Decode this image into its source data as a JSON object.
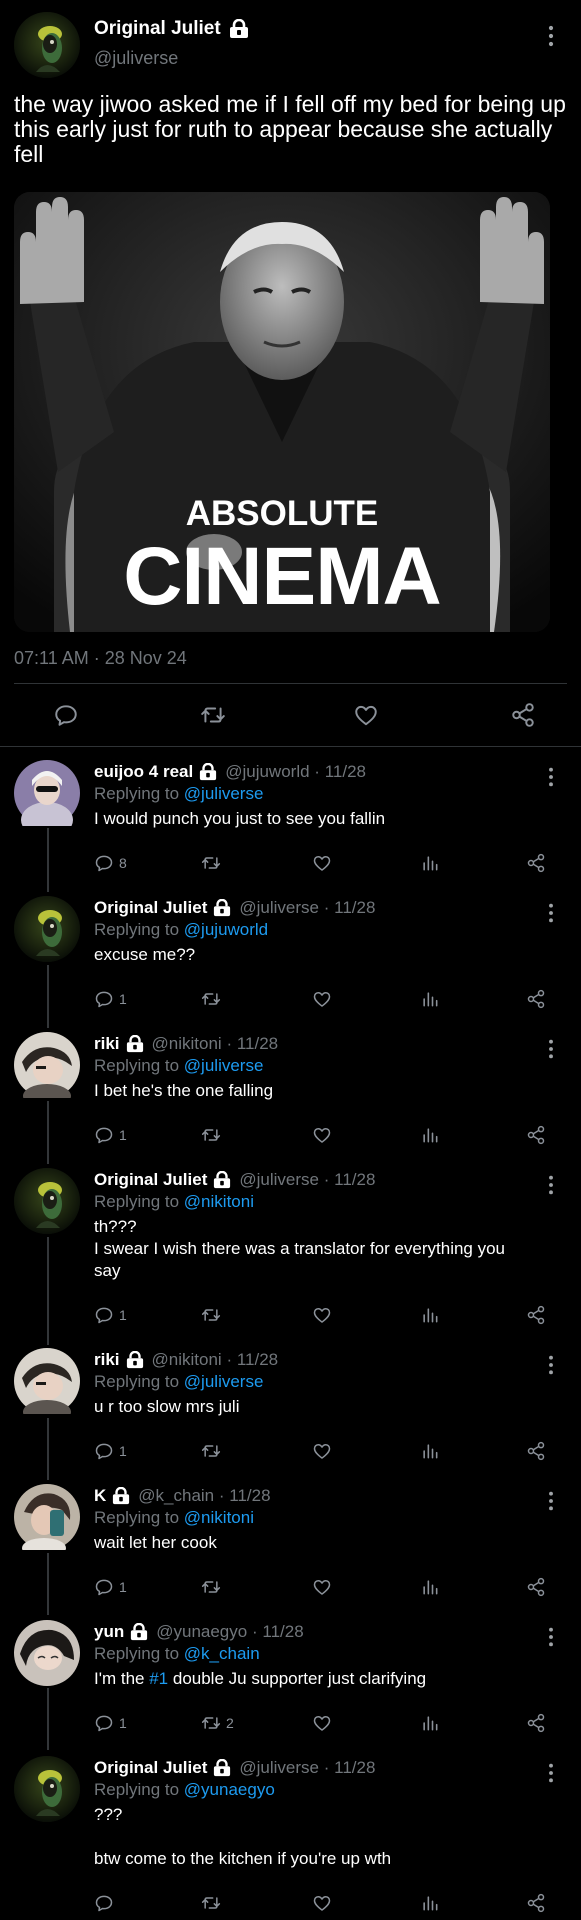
{
  "main_tweet": {
    "author_name": "Original Juliet",
    "author_handle": "@juliverse",
    "text": "the way jiwoo asked me if I fell off my bed for being up this early just for ruth to appear because she actually fell",
    "media_caption_small": "ABSOLUTE",
    "media_caption_large": "CINEMA",
    "timestamp": "07:11 AM · 28 Nov 24"
  },
  "replies": [
    {
      "name": "euijoo 4 real",
      "handle": "@jujuworld",
      "date": "11/28",
      "replying_to_label": "Replying to",
      "replying_to": "@juliverse",
      "lines": [
        "I would punch you just to see you fallin"
      ],
      "reply_count": "8",
      "retweet_count": ""
    },
    {
      "name": "Original Juliet",
      "handle": "@juliverse",
      "date": "11/28",
      "replying_to_label": "Replying to",
      "replying_to": "@jujuworld",
      "lines": [
        "excuse me??"
      ],
      "reply_count": "1",
      "retweet_count": ""
    },
    {
      "name": "riki",
      "handle": "@nikitoni",
      "date": "11/28",
      "replying_to_label": "Replying to",
      "replying_to": "@juliverse",
      "lines": [
        "I bet he's the one falling"
      ],
      "reply_count": "1",
      "retweet_count": ""
    },
    {
      "name": "Original Juliet",
      "handle": "@juliverse",
      "date": "11/28",
      "replying_to_label": "Replying to",
      "replying_to": "@nikitoni",
      "lines": [
        "th???",
        "I swear I wish there was a translator for everything you",
        "say"
      ],
      "reply_count": "1",
      "retweet_count": ""
    },
    {
      "name": "riki",
      "handle": "@nikitoni",
      "date": "11/28",
      "replying_to_label": "Replying to",
      "replying_to": "@juliverse",
      "lines": [
        "u r too slow mrs juli"
      ],
      "reply_count": "1",
      "retweet_count": ""
    },
    {
      "name": "K",
      "handle": "@k_chain",
      "date": "11/28",
      "replying_to_label": "Replying to",
      "replying_to": "@nikitoni",
      "lines": [
        "wait let her cook"
      ],
      "reply_count": "1",
      "retweet_count": ""
    },
    {
      "name": "yun",
      "handle": "@yunaegyo",
      "date": "11/28",
      "replying_to_label": "Replying to",
      "replying_to": "@k_chain",
      "lines_prefix": "I'm the ",
      "lines_hashtag": "#1",
      "lines_suffix": " double Ju supporter just clarifying",
      "reply_count": "1",
      "retweet_count": "2"
    },
    {
      "name": "Original Juliet",
      "handle": "@juliverse",
      "date": "11/28",
      "replying_to_label": "Replying to",
      "replying_to": "@yunaegyo",
      "lines": [
        "???",
        "",
        "btw come to the kitchen if you're up wth"
      ],
      "reply_count": "",
      "retweet_count": ""
    }
  ],
  "meta_separator": "·",
  "icons": {
    "lock": "lock-icon",
    "reply": "reply-icon",
    "retweet": "retweet-icon",
    "like": "heart-icon",
    "views": "views-icon",
    "share": "share-icon",
    "more": "more-vertical-icon"
  },
  "colors": {
    "background": "#000000",
    "link": "#1d9bf0",
    "muted": "#71767b",
    "text": "#e7e9ea"
  }
}
